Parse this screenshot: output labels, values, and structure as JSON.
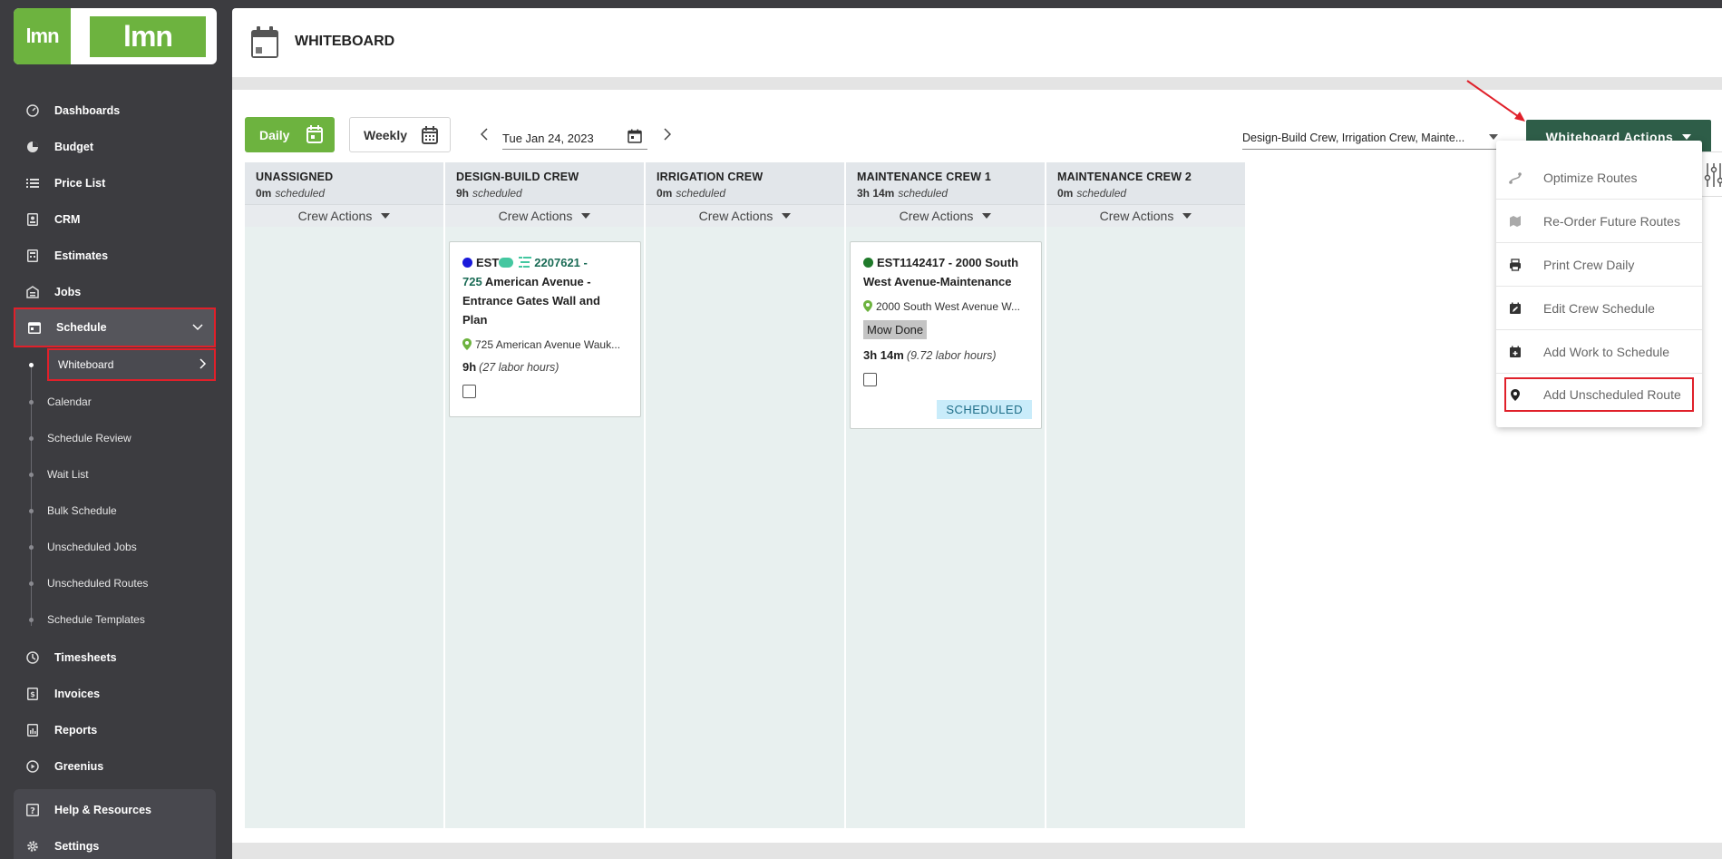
{
  "brand": {
    "logo_mark": "lmn",
    "logo_word": "lmn",
    "color": "#6db33f"
  },
  "sidebar": {
    "items": [
      {
        "id": "dashboards",
        "label": "Dashboards",
        "icon": "gauge-icon"
      },
      {
        "id": "budget",
        "label": "Budget",
        "icon": "pie-chart-icon"
      },
      {
        "id": "price-list",
        "label": "Price List",
        "icon": "list-icon"
      },
      {
        "id": "crm",
        "label": "CRM",
        "icon": "contacts-icon"
      },
      {
        "id": "estimates",
        "label": "Estimates",
        "icon": "calculator-icon"
      },
      {
        "id": "jobs",
        "label": "Jobs",
        "icon": "warehouse-icon"
      },
      {
        "id": "schedule",
        "label": "Schedule",
        "icon": "calendar-icon"
      }
    ],
    "schedule_sub": [
      {
        "id": "whiteboard",
        "label": "Whiteboard"
      },
      {
        "id": "calendar",
        "label": "Calendar"
      },
      {
        "id": "schedule-review",
        "label": "Schedule Review"
      },
      {
        "id": "wait-list",
        "label": "Wait List"
      },
      {
        "id": "bulk-schedule",
        "label": "Bulk Schedule"
      },
      {
        "id": "unscheduled-jobs",
        "label": "Unscheduled Jobs"
      },
      {
        "id": "unscheduled-routes",
        "label": "Unscheduled Routes"
      },
      {
        "id": "schedule-templates",
        "label": "Schedule Templates"
      }
    ],
    "lower_items": [
      {
        "id": "timesheets",
        "label": "Timesheets",
        "icon": "clock-icon"
      },
      {
        "id": "invoices",
        "label": "Invoices",
        "icon": "invoice-icon"
      },
      {
        "id": "reports",
        "label": "Reports",
        "icon": "report-icon"
      },
      {
        "id": "greenius",
        "label": "Greenius",
        "icon": "play-circle-icon"
      }
    ],
    "footer_items": [
      {
        "id": "help",
        "label": "Help & Resources",
        "icon": "help-icon"
      },
      {
        "id": "settings",
        "label": "Settings",
        "icon": "gear-icon"
      }
    ]
  },
  "header": {
    "title": "WHITEBOARD"
  },
  "toolbar": {
    "daily_label": "Daily",
    "weekly_label": "Weekly",
    "date_value": "Tue Jan 24, 2023",
    "crew_filter": "Design-Build Crew, Irrigation Crew, Mainte...",
    "actions_label": "Whiteboard Actions"
  },
  "columns": [
    {
      "name": "UNASSIGNED",
      "time": "0m",
      "sched": "scheduled",
      "actions": "Crew Actions"
    },
    {
      "name": "DESIGN-BUILD CREW",
      "time": "9h",
      "sched": "scheduled",
      "actions": "Crew Actions"
    },
    {
      "name": "IRRIGATION CREW",
      "time": "0m",
      "sched": "scheduled",
      "actions": "Crew Actions"
    },
    {
      "name": "MAINTENANCE CREW 1",
      "time": "3h 14m",
      "sched": "scheduled",
      "actions": "Crew Actions"
    },
    {
      "name": "MAINTENANCE CREW 2",
      "time": "0m",
      "sched": "scheduled",
      "actions": "Crew Actions"
    }
  ],
  "cards": {
    "c1": {
      "dot_color": "#1a1adb",
      "prefix": "EST",
      "code": "2207621 -",
      "code2": "725",
      "title_rest": "American Avenue - Entrance Gates Wall and Plan",
      "address": "725 American Avenue Wauk...",
      "hours": "9h",
      "labor": "(27 labor hours)"
    },
    "c2": {
      "dot_color": "#1f7a2a",
      "title": "EST1142417 - 2000 South West Avenue-Maintenance",
      "address": "2000 South West Avenue W...",
      "badge": "Mow Done",
      "hours": "3h 14m",
      "labor": "(9.72 labor hours)",
      "status": "SCHEDULED"
    }
  },
  "dropdown": {
    "items": [
      {
        "id": "optimize",
        "label": "Optimize Routes",
        "icon": "route-icon"
      },
      {
        "id": "reorder",
        "label": "Re-Order Future Routes",
        "icon": "map-icon"
      },
      {
        "id": "print",
        "label": "Print Crew Daily",
        "icon": "printer-icon"
      },
      {
        "id": "edit",
        "label": "Edit Crew Schedule",
        "icon": "calendar-edit-icon"
      },
      {
        "id": "add-work",
        "label": "Add Work to Schedule",
        "icon": "calendar-plus-icon"
      },
      {
        "id": "add-route",
        "label": "Add Unscheduled Route",
        "icon": "map-pin-icon"
      }
    ]
  },
  "colors": {
    "accent_green": "#6db33f",
    "dark_green": "#2e5d48",
    "highlight_red": "#e0202a"
  }
}
